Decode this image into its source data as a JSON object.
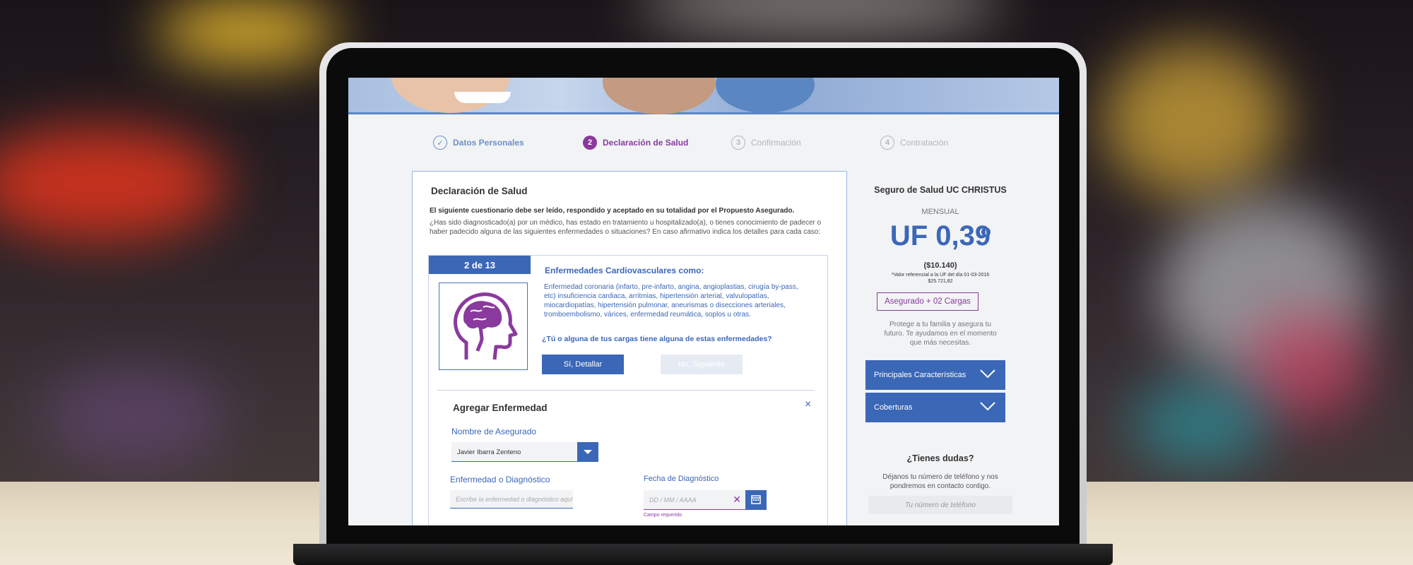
{
  "steps": [
    {
      "number": "✓",
      "label": "Datos Personales",
      "state": "done"
    },
    {
      "number": "2",
      "label": "Declaración de Salud",
      "state": "active"
    },
    {
      "number": "3",
      "label": "Confirmación",
      "state": "pending"
    },
    {
      "number": "4",
      "label": "Contratación",
      "state": "pending"
    }
  ],
  "form": {
    "title": "Declaración de Salud",
    "intro_bold": "El siguiente cuestionario debe ser leído, respondido y aceptado en su totalidad por el Propuesto Asegurado.",
    "intro_line1": "¿Has sido diagnosticado(a) por un médico, has estado en tratamiento u hospitalizado(a), o tienes conocimiento de padecer o",
    "intro_line2": "haber padecido alguna de las siguientes enfermedades o situaciones? En caso afirmativo indica los detalles para cada caso:",
    "question": {
      "counter": "2 de 13",
      "category_title": "Enfermedades Cardiovasculares como:",
      "desc_line1": "Enfermedad coronaria (infarto, pre-infarto, angina, angioplastias, cirugía by-pass,",
      "desc_line2": "etc) insuficiencia cardiaca, arritmias, hipertensión arterial, valvulopatías,",
      "desc_line3": "miocardiopatías, hipertensión pulmonar, aneurismas o disecciones arteriales,",
      "desc_line4": "tromboembolismo, várices, enfermedad reumática, soplos u otras.",
      "prompt": "¿Tú o alguna de tus cargas tiene alguna de estas enfermedades?",
      "yes_button": "Sí, Detallar",
      "no_button": "No, Siguiente"
    },
    "add_disease": {
      "title": "Agregar Enfermedad",
      "close": "×",
      "insured_label": "Nombre de Asegurado",
      "insured_value": "Javier Ibarra Zenteno",
      "diagnosis_label": "Enfermedad o Diagnóstico",
      "diagnosis_placeholder": "Escribe la enfermedad o diagnóstico aquí",
      "date_label": "Fecha de Diagnóstico",
      "date_placeholder": "DD / MM / AAAA",
      "date_error": "Campo requerido"
    }
  },
  "sidebar": {
    "plan_title": "Seguro de Salud UC CHRISTUS",
    "period": "MENSUAL",
    "price": "UF 0,39",
    "info_icon": "info-icon",
    "price_clp": "($10.140)",
    "note_line1": "*Valor referencial a la UF del día 01-03-2016",
    "note_line2": "$25.721,82",
    "coverage_badge": "Asegurado + 02 Cargas",
    "pitch_line1": "Protege a tu familia y asegura tu",
    "pitch_line2": "futuro. Te ayudamos en el momento",
    "pitch_line3": "que más necesitas.",
    "accordion": [
      {
        "label": "Principales Características"
      },
      {
        "label": "Coberturas"
      }
    ],
    "help_title": "¿Tienes dudas?",
    "help_line1": "Déjanos tu número de teléfono y nos",
    "help_line2": "pondremos en contacto contigo.",
    "phone_placeholder": "Tu número de teléfono"
  },
  "colors": {
    "brand_blue": "#3b67b7",
    "accent_purple": "#8a3a9e",
    "muted_gray": "#b5b5b5"
  }
}
